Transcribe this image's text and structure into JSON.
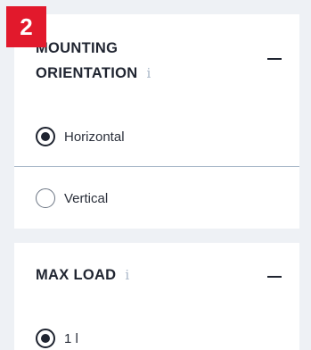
{
  "step_badge": "2",
  "mounting": {
    "title_line1": "MOUNTING",
    "title_line2": "ORIENTATION",
    "info_icon": "i",
    "options": [
      {
        "label": "Horizontal",
        "selected": true
      },
      {
        "label": "Vertical",
        "selected": false
      }
    ]
  },
  "max_load": {
    "title": "MAX LOAD",
    "info_icon": "i",
    "options": [
      {
        "label": "1 l",
        "selected": true
      }
    ]
  }
}
